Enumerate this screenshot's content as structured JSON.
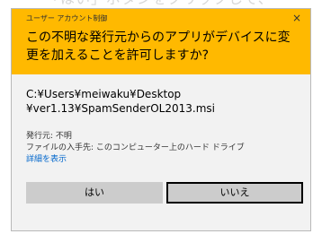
{
  "background": {
    "partial_text": "「はい」ボタンをクリックして、"
  },
  "dialog": {
    "uac_label": "ユーザー アカウント制御",
    "close_glyph": "×",
    "question": "この不明な発行元からのアプリがデバイスに変更を加えることを許可しますか?",
    "program_path_line1": "C:¥Users¥meiwaku¥Desktop",
    "program_path_line2": "¥ver1.13¥SpamSenderOL2013.msi",
    "publisher": "発行元: 不明",
    "file_origin": "ファイルの入手先: このコンピューター上のハード ドライブ",
    "details_link": "詳細を表示",
    "yes_label": "はい",
    "no_label": "いいえ"
  },
  "colors": {
    "header": "#ffb900",
    "body": "#f2f2f2",
    "button": "#cccccc",
    "link": "#0066cc"
  }
}
